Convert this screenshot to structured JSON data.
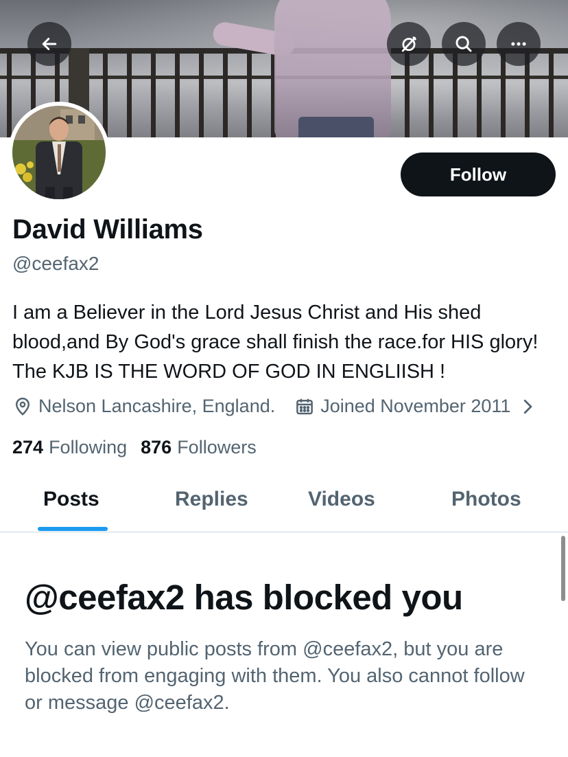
{
  "header": {
    "back_icon": "arrow-left-icon",
    "mute_icon": "notifications-off-icon",
    "search_icon": "search-icon",
    "more_icon": "more-horizontal-icon"
  },
  "profile": {
    "name": "David Williams",
    "handle": "@ceefax2",
    "follow_label": "Follow",
    "bio": "I am a Believer in the Lord Jesus Christ and His shed blood,and By God's grace shall finish the race.for HIS glory! The KJB IS THE WORD OF GOD IN ENGLIISH !",
    "location": "Nelson Lancashire, England.",
    "joined": "Joined November 2011",
    "following_count": "274",
    "following_label": "Following",
    "followers_count": "876",
    "followers_label": "Followers"
  },
  "tabs": [
    {
      "label": "Posts",
      "active": true
    },
    {
      "label": "Replies",
      "active": false
    },
    {
      "label": "Videos",
      "active": false
    },
    {
      "label": "Photos",
      "active": false
    }
  ],
  "blocked": {
    "title": "@ceefax2 has blocked you",
    "message": "You can view public posts from @ceefax2, but you are blocked from engaging with them. You also cannot follow or message @ceefax2."
  },
  "colors": {
    "accent": "#1d9bf0",
    "text_primary": "#0f1419",
    "text_secondary": "#536471"
  }
}
